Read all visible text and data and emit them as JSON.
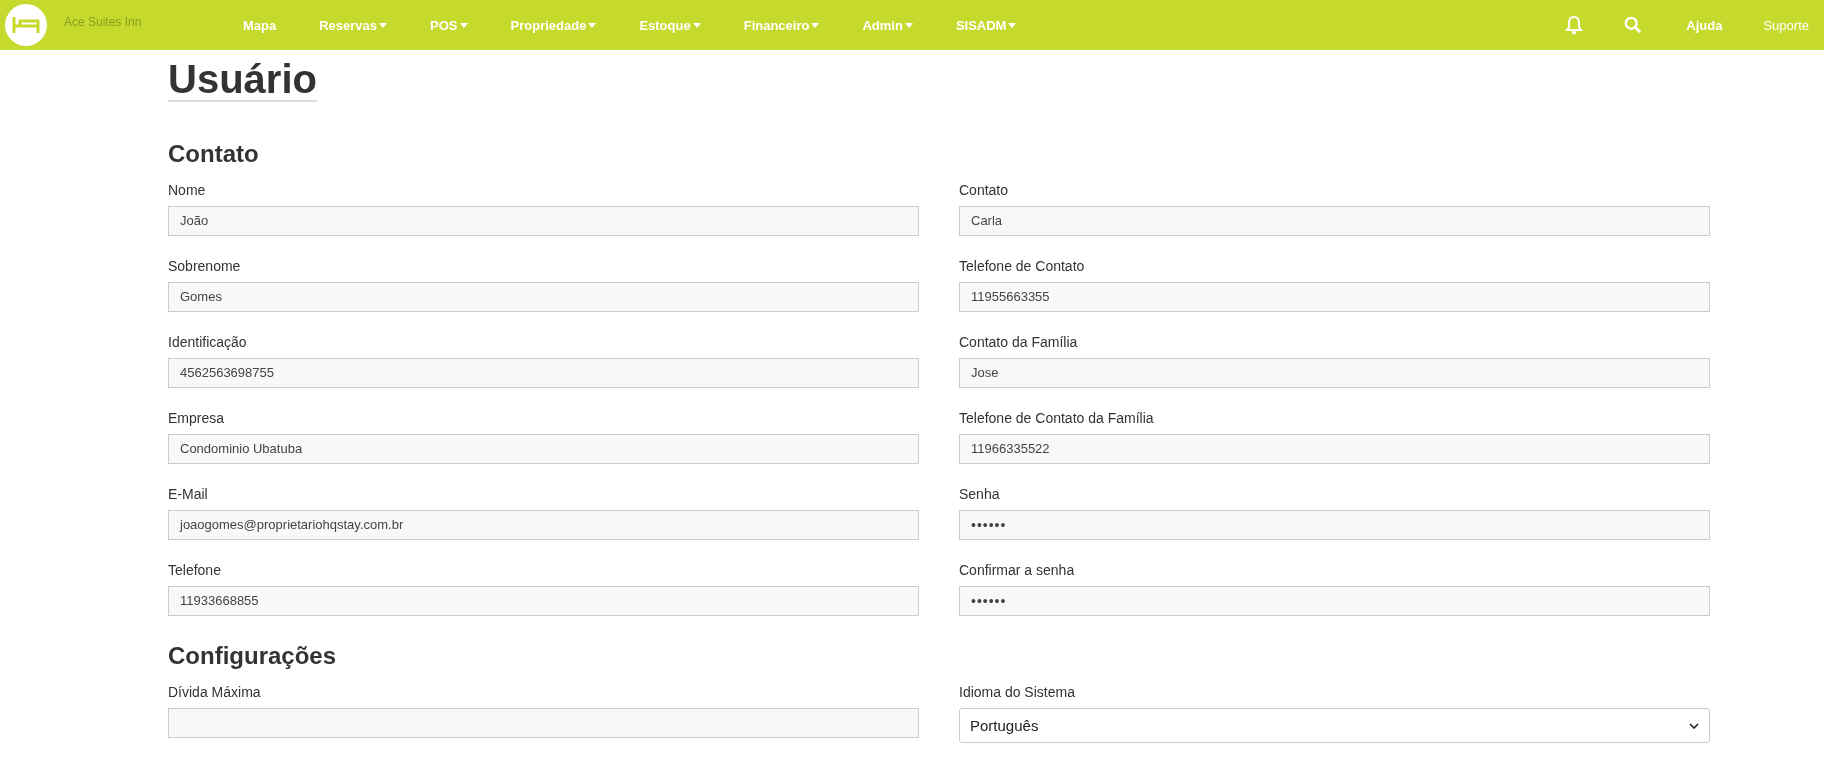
{
  "brand": "Ace Suites Inn",
  "nav": [
    {
      "label": "Mapa",
      "dropdown": false
    },
    {
      "label": "Reservas",
      "dropdown": true
    },
    {
      "label": "POS",
      "dropdown": true
    },
    {
      "label": "Propriedade",
      "dropdown": true
    },
    {
      "label": "Estoque",
      "dropdown": true
    },
    {
      "label": "Financeiro",
      "dropdown": true
    },
    {
      "label": "Admin",
      "dropdown": true
    },
    {
      "label": "SISADM",
      "dropdown": true
    }
  ],
  "nav_right": [
    {
      "kind": "bell"
    },
    {
      "kind": "search"
    },
    {
      "kind": "link",
      "label": "Ajuda",
      "bold": true
    },
    {
      "kind": "link",
      "label": "Suporte",
      "bold": false
    }
  ],
  "title": "Usuário",
  "sections": [
    {
      "title": "Contato",
      "fields": [
        {
          "label": "Nome",
          "value": "João",
          "kind": "text"
        },
        {
          "label": "Contato",
          "value": "Carla",
          "kind": "text"
        },
        {
          "label": "Sobrenome",
          "value": "Gomes",
          "kind": "text"
        },
        {
          "label": "Telefone de Contato",
          "value": "11955663355",
          "kind": "text"
        },
        {
          "label": "Identificação",
          "value": "4562563698755",
          "kind": "text"
        },
        {
          "label": "Contato da Família",
          "value": "Jose",
          "kind": "text"
        },
        {
          "label": "Empresa",
          "value": "Condominio Ubatuba",
          "kind": "text"
        },
        {
          "label": "Telefone de Contato da Família",
          "value": "11966335522",
          "kind": "text"
        },
        {
          "label": "E-Mail",
          "value": "joaogomes@proprietariohqstay.com.br",
          "kind": "text"
        },
        {
          "label": "Senha",
          "value": "••••••",
          "kind": "password"
        },
        {
          "label": "Telefone",
          "value": "11933668855",
          "kind": "text"
        },
        {
          "label": "Confirmar a senha",
          "value": "••••••",
          "kind": "password"
        }
      ]
    },
    {
      "title": "Configurações",
      "fields": [
        {
          "label": "Dívida Máxima",
          "kind": "text"
        },
        {
          "label": "Idioma do Sistema",
          "value": "Português",
          "kind": "select"
        }
      ]
    }
  ]
}
